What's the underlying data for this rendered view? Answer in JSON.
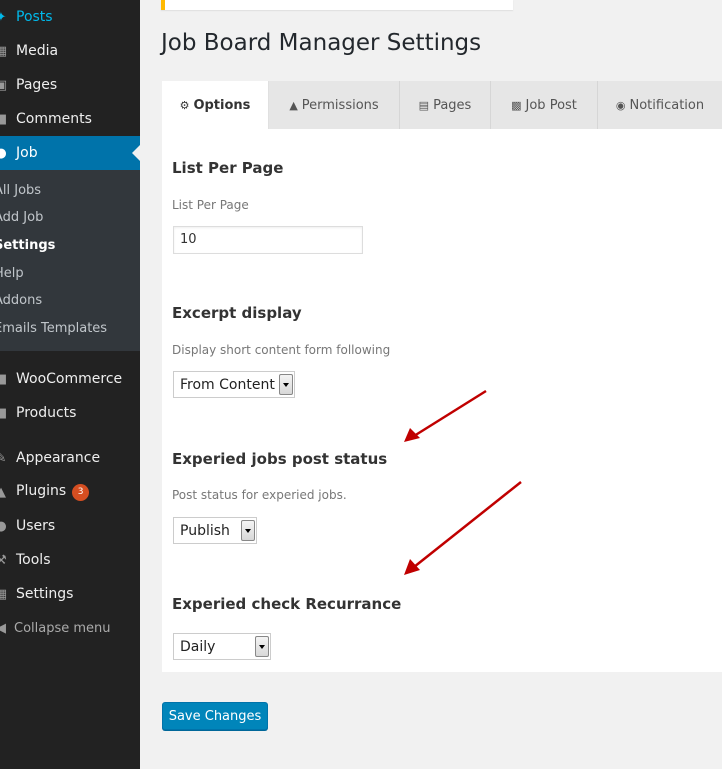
{
  "sidebar": {
    "menu": [
      {
        "key": "posts",
        "label": "Posts",
        "icon": "pin-icon"
      },
      {
        "key": "media",
        "label": "Media",
        "icon": "media-icon"
      },
      {
        "key": "pages",
        "label": "Pages",
        "icon": "pages-icon"
      },
      {
        "key": "comments",
        "label": "Comments",
        "icon": "comment-icon"
      },
      {
        "key": "job",
        "label": "Job",
        "icon": "job-icon"
      },
      {
        "key": "woocommerce",
        "label": "WooCommerce",
        "icon": "woocommerce-icon"
      },
      {
        "key": "products",
        "label": "Products",
        "icon": "products-icon"
      },
      {
        "key": "appearance",
        "label": "Appearance",
        "icon": "brush-icon"
      },
      {
        "key": "plugins",
        "label": "Plugins",
        "icon": "plugin-icon",
        "badge": "3"
      },
      {
        "key": "users",
        "label": "Users",
        "icon": "users-icon"
      },
      {
        "key": "tools",
        "label": "Tools",
        "icon": "tools-icon"
      },
      {
        "key": "settings",
        "label": "Settings",
        "icon": "settings-icon"
      }
    ],
    "submenu": [
      "All Jobs",
      "Add Job",
      "Settings",
      "Help",
      "Addons",
      "Emails Templates"
    ],
    "current_submenu": "Settings",
    "collapse_label": "Collapse menu"
  },
  "page": {
    "title": "Job Board Manager Settings"
  },
  "tabs": [
    {
      "label": "Options",
      "icon": "gears-icon",
      "active": true
    },
    {
      "label": "Permissions",
      "icon": "warning-icon",
      "active": false
    },
    {
      "label": "Pages",
      "icon": "file-icon",
      "active": false
    },
    {
      "label": "Job Post",
      "icon": "briefcase-icon",
      "active": false
    },
    {
      "label": "Notification",
      "icon": "bell-icon",
      "active": false
    }
  ],
  "sections": {
    "list_per_page": {
      "title": "List Per Page",
      "desc": "List Per Page",
      "value": "10"
    },
    "excerpt": {
      "title": "Excerpt display",
      "desc": "Display short content form following",
      "value": "From Content"
    },
    "expired_status": {
      "title": "Experied jobs post status",
      "desc": "Post status for experied jobs.",
      "value": "Publish"
    },
    "expired_recurrance": {
      "title": "Experied check Recurrance",
      "value": "Daily"
    }
  },
  "actions": {
    "save_label": "Save Changes"
  },
  "colors": {
    "sidebar_bg": "#222222",
    "active_menu": "#0073aa",
    "primary_button": "#0085ba",
    "annotation_arrow": "#c00000",
    "badge": "#d54e21"
  }
}
